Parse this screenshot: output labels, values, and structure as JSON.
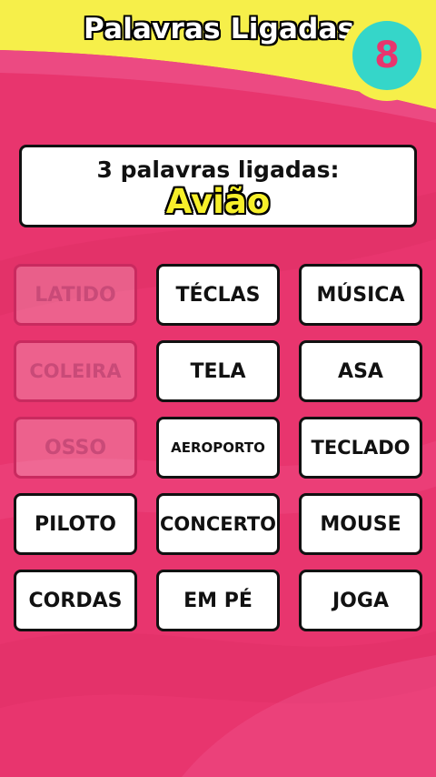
{
  "header": {
    "title": "Palavras Ligadas",
    "level": "8"
  },
  "clue": {
    "label": "3 palavras ligadas:",
    "word": "Avião"
  },
  "tiles": [
    {
      "label": "LATIDO",
      "state": "used"
    },
    {
      "label": "TÉCLAS",
      "state": "active"
    },
    {
      "label": "MÚSICA",
      "state": "active"
    },
    {
      "label": "COLEIRA",
      "state": "used"
    },
    {
      "label": "TELA",
      "state": "active"
    },
    {
      "label": "ASA",
      "state": "active"
    },
    {
      "label": "OSSO",
      "state": "used"
    },
    {
      "label": "AEROPORTO",
      "state": "active"
    },
    {
      "label": "TECLADO",
      "state": "active"
    },
    {
      "label": "PILOTO",
      "state": "active"
    },
    {
      "label": "CONCERTO",
      "state": "active"
    },
    {
      "label": "MOUSE",
      "state": "active"
    },
    {
      "label": "CORDAS",
      "state": "active"
    },
    {
      "label": "EM PÉ",
      "state": "active"
    },
    {
      "label": "JOGA",
      "state": "active"
    }
  ],
  "colors": {
    "background": "#e8356e",
    "accent_yellow": "#f6ef4a",
    "badge_teal": "#35d6c9"
  }
}
